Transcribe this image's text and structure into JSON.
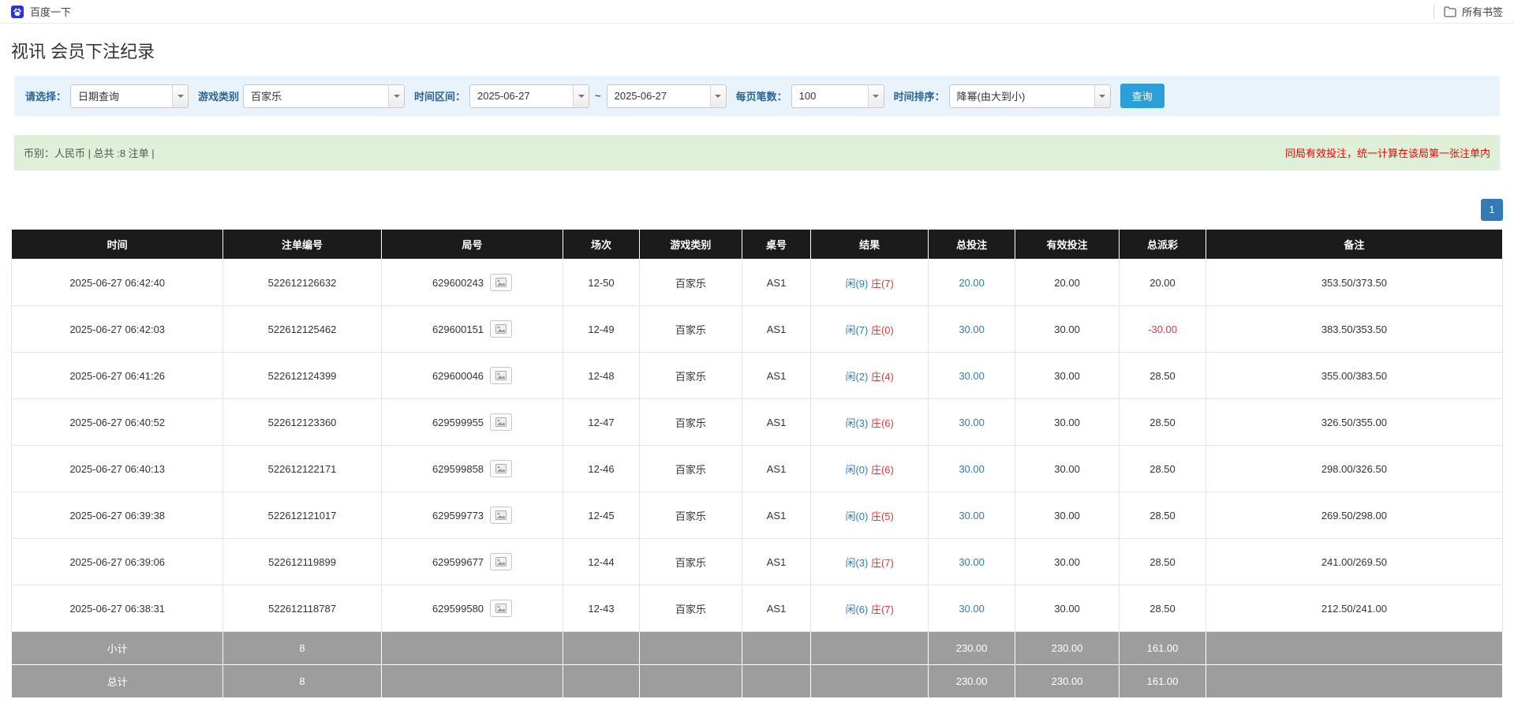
{
  "colors": {
    "accent_blue": "#2d9fd8",
    "link_blue": "#337ab7",
    "banker_red": "#e4393c",
    "note_red": "#ff0000",
    "header_black": "#1b1b1b",
    "summary_gray": "#9d9d9d",
    "filter_bar_bg": "#e8f3fb",
    "info_bar_bg": "#dff0d8"
  },
  "bookmarks_bar": {
    "bookmark_label": "百度一下",
    "all_bookmarks_label": "所有书签"
  },
  "page": {
    "title": "视讯 会员下注纪录"
  },
  "filters": {
    "query_type_label": "请选择：",
    "query_type_value": "日期查询",
    "game_type_label": "游戏类别",
    "game_type_value": "百家乐",
    "date_range_label": "时间区间：",
    "date_from": "2025-06-27",
    "range_separator": "~",
    "date_to": "2025-06-27",
    "page_size_label": "每页笔数：",
    "page_size_value": "100",
    "sort_label": "时间排序：",
    "sort_value": "降幂(由大到小)",
    "search_button_label": "查询"
  },
  "info_bar": {
    "summary_text": "币别：人民币 | 总共 :8 注单 |",
    "note_text": "同局有效投注，统一计算在该局第一张注单内"
  },
  "pagination": {
    "current_page": "1"
  },
  "table": {
    "headers": [
      "时间",
      "注单编号",
      "局号",
      "场次",
      "游戏类别",
      "桌号",
      "结果",
      "总投注",
      "有效投注",
      "总派彩",
      "备注"
    ],
    "rows": [
      {
        "time": "2025-06-27 06:42:40",
        "bet_id": "522612126632",
        "round_no": "629600243",
        "session": "12-50",
        "game_type": "百家乐",
        "table_no": "AS1",
        "result_player": "闲(9)",
        "result_banker": "庄(7)",
        "total_bet": "20.00",
        "valid_bet": "20.00",
        "payout": "20.00",
        "note": "353.50/373.50"
      },
      {
        "time": "2025-06-27 06:42:03",
        "bet_id": "522612125462",
        "round_no": "629600151",
        "session": "12-49",
        "game_type": "百家乐",
        "table_no": "AS1",
        "result_player": "闲(7)",
        "result_banker": "庄(0)",
        "total_bet": "30.00",
        "valid_bet": "30.00",
        "payout": "-30.00",
        "note": "383.50/353.50"
      },
      {
        "time": "2025-06-27 06:41:26",
        "bet_id": "522612124399",
        "round_no": "629600046",
        "session": "12-48",
        "game_type": "百家乐",
        "table_no": "AS1",
        "result_player": "闲(2)",
        "result_banker": "庄(4)",
        "total_bet": "30.00",
        "valid_bet": "30.00",
        "payout": "28.50",
        "note": "355.00/383.50"
      },
      {
        "time": "2025-06-27 06:40:52",
        "bet_id": "522612123360",
        "round_no": "629599955",
        "session": "12-47",
        "game_type": "百家乐",
        "table_no": "AS1",
        "result_player": "闲(3)",
        "result_banker": "庄(6)",
        "total_bet": "30.00",
        "valid_bet": "30.00",
        "payout": "28.50",
        "note": "326.50/355.00"
      },
      {
        "time": "2025-06-27 06:40:13",
        "bet_id": "522612122171",
        "round_no": "629599858",
        "session": "12-46",
        "game_type": "百家乐",
        "table_no": "AS1",
        "result_player": "闲(0)",
        "result_banker": "庄(6)",
        "total_bet": "30.00",
        "valid_bet": "30.00",
        "payout": "28.50",
        "note": "298.00/326.50"
      },
      {
        "time": "2025-06-27 06:39:38",
        "bet_id": "522612121017",
        "round_no": "629599773",
        "session": "12-45",
        "game_type": "百家乐",
        "table_no": "AS1",
        "result_player": "闲(0)",
        "result_banker": "庄(5)",
        "total_bet": "30.00",
        "valid_bet": "30.00",
        "payout": "28.50",
        "note": "269.50/298.00"
      },
      {
        "time": "2025-06-27 06:39:06",
        "bet_id": "522612119899",
        "round_no": "629599677",
        "session": "12-44",
        "game_type": "百家乐",
        "table_no": "AS1",
        "result_player": "闲(3)",
        "result_banker": "庄(7)",
        "total_bet": "30.00",
        "valid_bet": "30.00",
        "payout": "28.50",
        "note": "241.00/269.50"
      },
      {
        "time": "2025-06-27 06:38:31",
        "bet_id": "522612118787",
        "round_no": "629599580",
        "session": "12-43",
        "game_type": "百家乐",
        "table_no": "AS1",
        "result_player": "闲(6)",
        "result_banker": "庄(7)",
        "total_bet": "30.00",
        "valid_bet": "30.00",
        "payout": "28.50",
        "note": "212.50/241.00"
      }
    ],
    "subtotal_row": {
      "label": "小计",
      "count": "8",
      "total_bet": "230.00",
      "valid_bet": "230.00",
      "payout": "161.00"
    },
    "total_row": {
      "label": "总计",
      "count": "8",
      "total_bet": "230.00",
      "valid_bet": "230.00",
      "payout": "161.00"
    }
  }
}
